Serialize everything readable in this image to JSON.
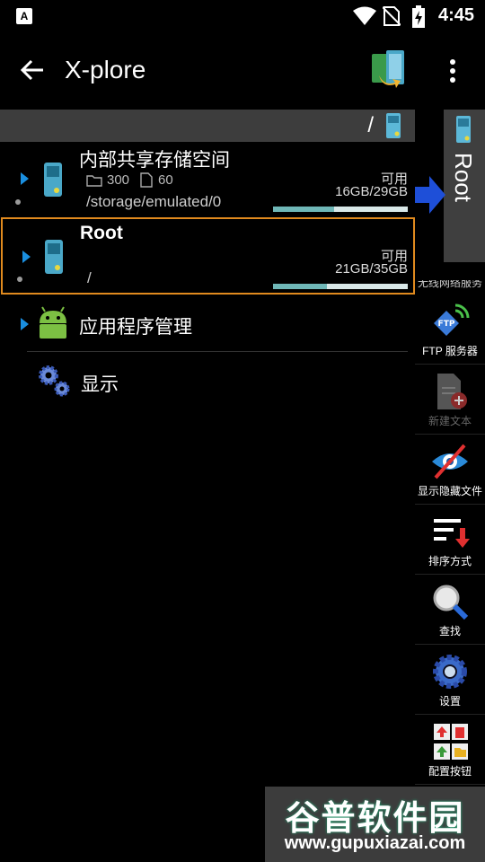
{
  "status": {
    "time": "4:45",
    "notification_letter": "A"
  },
  "appbar": {
    "title": "X-plore"
  },
  "pathbar": {
    "path": "/"
  },
  "root_tab": {
    "label": "Root"
  },
  "storage": [
    {
      "name": "内部共享存储空间",
      "folders": "300",
      "files": "60",
      "path": "/storage/emulated/0",
      "avail_label": "可用",
      "size": "16GB/29GB",
      "used_fraction": 0.45
    },
    {
      "name": "Root",
      "path": "/",
      "avail_label": "可用",
      "size": "21GB/35GB",
      "used_fraction": 0.4
    }
  ],
  "entries": [
    {
      "name": "应用程序管理"
    },
    {
      "name": "显示"
    }
  ],
  "dock": {
    "cut_label": "无线网络服务",
    "buttons": [
      {
        "label": "FTP 服务器",
        "icon": "ftp-icon",
        "enabled": true
      },
      {
        "label": "新建文本",
        "icon": "new-text-icon",
        "enabled": false
      },
      {
        "label": "显示隐藏文件",
        "icon": "eye-hidden-icon",
        "enabled": true
      },
      {
        "label": "排序方式",
        "icon": "sort-icon",
        "enabled": true
      },
      {
        "label": "查找",
        "icon": "search-icon",
        "enabled": true
      },
      {
        "label": "设置",
        "icon": "gear-icon",
        "enabled": true
      },
      {
        "label": "配置按钮",
        "icon": "configure-buttons-icon",
        "enabled": true
      }
    ]
  },
  "watermark": {
    "title": "谷普软件园",
    "url": "www.gupuxiazai.com"
  },
  "colors": {
    "accent_blue": "#1a8fe0",
    "highlight_orange": "#e08a1e",
    "pathbar_bg": "#3d3d3d"
  }
}
